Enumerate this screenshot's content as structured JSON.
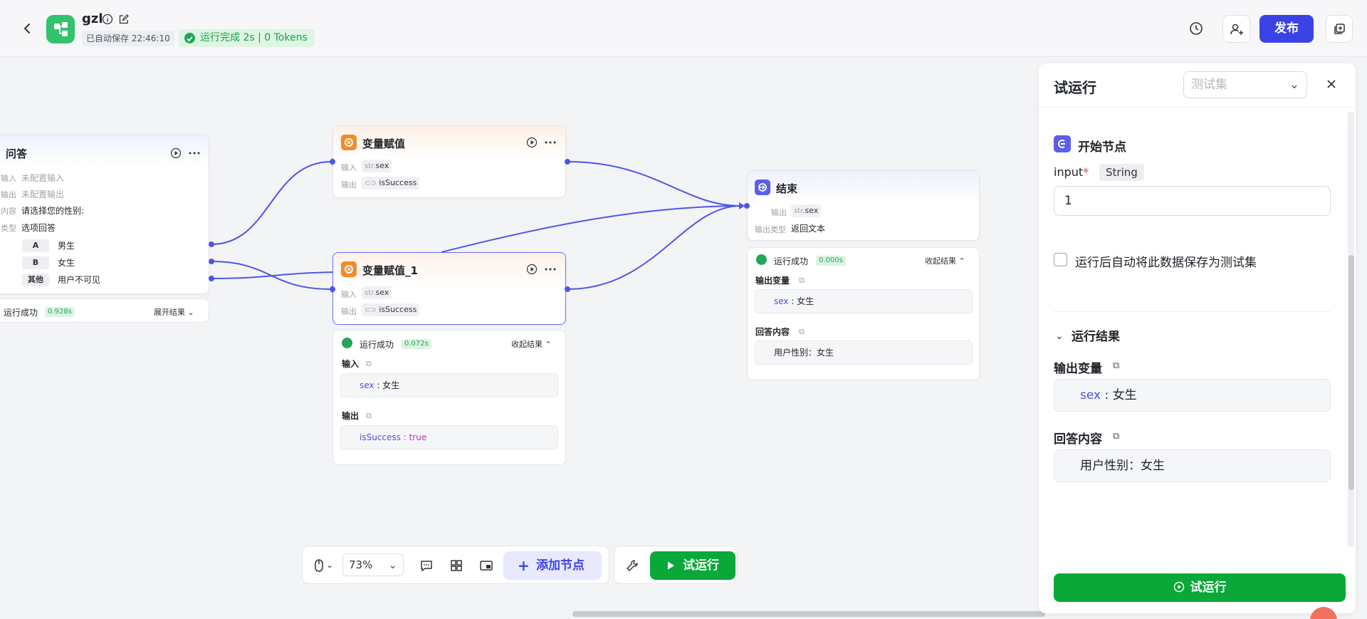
{
  "header": {
    "app_name": "gzl",
    "autosave": "已自动保存 22:46:10",
    "run_status": "运行完成 2s | 0 Tokens",
    "publish_label": "发布"
  },
  "nodes": {
    "qa": {
      "title": "问答",
      "input_label": "输入",
      "input_value": "未配置输入",
      "output_label": "输出",
      "output_value": "未配置输出",
      "content_label": "内容",
      "content_value": "请选择您的性别:",
      "type_label": "类型",
      "type_value": "选项回答",
      "options": [
        {
          "key": "A",
          "text": "男生"
        },
        {
          "key": "B",
          "text": "女生"
        },
        {
          "key": "其他",
          "text": "用户不可见"
        }
      ],
      "run_status": "运行成功",
      "run_time": "0.928s",
      "expand_label": "展开结果"
    },
    "assign1": {
      "title": "变量赋值",
      "input_label": "输入",
      "input_prefix": "str.",
      "input_value": "sex",
      "output_label": "输出",
      "output_value": "isSuccess"
    },
    "assign2": {
      "title": "变量赋值_1",
      "input_label": "输入",
      "input_prefix": "str.",
      "input_value": "sex",
      "output_label": "输出",
      "output_value": "isSuccess",
      "run_status": "运行成功",
      "run_time": "0.072s",
      "collapse_label": "收起结果",
      "res_input_label": "输入",
      "res_input_var": "sex",
      "res_input_val": ": 女生",
      "res_output_label": "输出",
      "res_output_var": "isSuccess",
      "res_output_val": ": true"
    },
    "end": {
      "title": "结束",
      "output_label": "输出",
      "output_prefix": "str.",
      "output_value": "sex",
      "out_type_label": "输出类型",
      "out_type_value": "返回文本",
      "run_status": "运行成功",
      "run_time": "0.000s",
      "collapse_label": "收起结果",
      "res_output_label": "输出变量",
      "res_output_var": "sex",
      "res_output_val": ": 女生",
      "res_answer_label": "回答内容",
      "res_answer_val": "用户性别：女生"
    }
  },
  "toolbar": {
    "zoom": "73%",
    "add_node_label": "添加节点",
    "run_label": "试运行"
  },
  "side_panel": {
    "title": "试运行",
    "testset_placeholder": "测试集",
    "start_node_title": "开始节点",
    "input_label": "input",
    "input_required": "*",
    "input_type": "String",
    "input_value": "1",
    "save_checkbox_label": "运行后自动将此数据保存为测试集",
    "results_title": "运行结果",
    "output_var_label": "输出变量",
    "output_var_name": "sex",
    "output_var_value": ": 女生",
    "answer_label": "回答内容",
    "answer_value": "用户性别：女生",
    "run_button_label": "试运行"
  },
  "colors": {
    "accent": "#3b43e6",
    "success": "#0aa838",
    "edge": "#4f55e8",
    "assign_icon": "#f28b2c"
  }
}
